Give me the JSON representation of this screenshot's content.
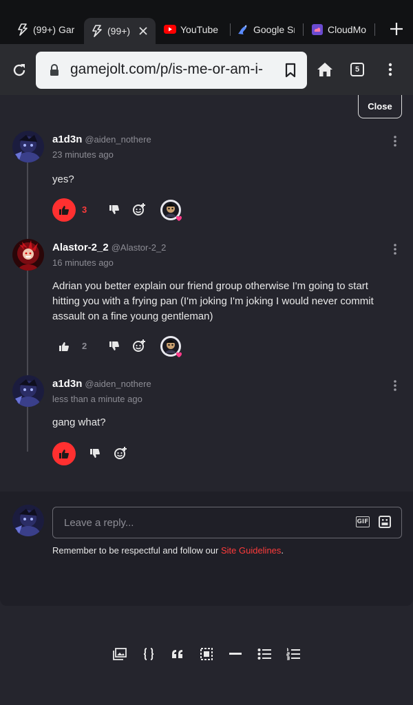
{
  "browser": {
    "tabs": [
      {
        "title": "(99+) Gar",
        "favicon": "gamejolt-bolt-icon"
      },
      {
        "title": "(99+)",
        "favicon": "gamejolt-bolt-icon",
        "active": true
      },
      {
        "title": "YouTube",
        "favicon": "youtube-icon"
      },
      {
        "title": "Google Sr",
        "favicon": "google-scholar-icon"
      },
      {
        "title": "CloudMo",
        "favicon": "cloudmoon-icon"
      }
    ],
    "url": "gamejolt.com/p/is-me-or-am-i-",
    "tab_count": "5"
  },
  "close_label": "Close",
  "comments": [
    {
      "username": "a1d3n",
      "handle": "@aiden_nothere",
      "time": "23 minutes ago",
      "text": "yes?",
      "likes": "3",
      "liked": true,
      "has_reaction": true
    },
    {
      "username": "Alastor-2_2",
      "handle": "@Alastor-2_2",
      "time": "16 minutes ago",
      "text": "Adrian you better explain our friend group otherwise I'm going to start hitting you with a frying pan (I'm joking I'm joking I would never commit assault on a fine young gentleman)",
      "likes": "2",
      "liked": false,
      "has_reaction": true
    },
    {
      "username": "a1d3n",
      "handle": "@aiden_nothere",
      "time": "less than a minute ago",
      "text": "gang what?",
      "likes": "",
      "liked": true,
      "has_reaction": false
    }
  ],
  "reply": {
    "placeholder": "Leave a reply...",
    "gif_label": "GIF",
    "guidelines_prefix": "Remember to be respectful and follow our ",
    "guidelines_link": "Site Guidelines",
    "guidelines_suffix": "."
  },
  "colors": {
    "accent": "#ff3030",
    "background": "#25252d",
    "panel": "#1f1f27"
  },
  "editor_toolbar": [
    "image-icon",
    "code-icon",
    "quote-icon",
    "spoiler-icon",
    "divider-icon",
    "bullet-list-icon",
    "numbered-list-icon"
  ]
}
